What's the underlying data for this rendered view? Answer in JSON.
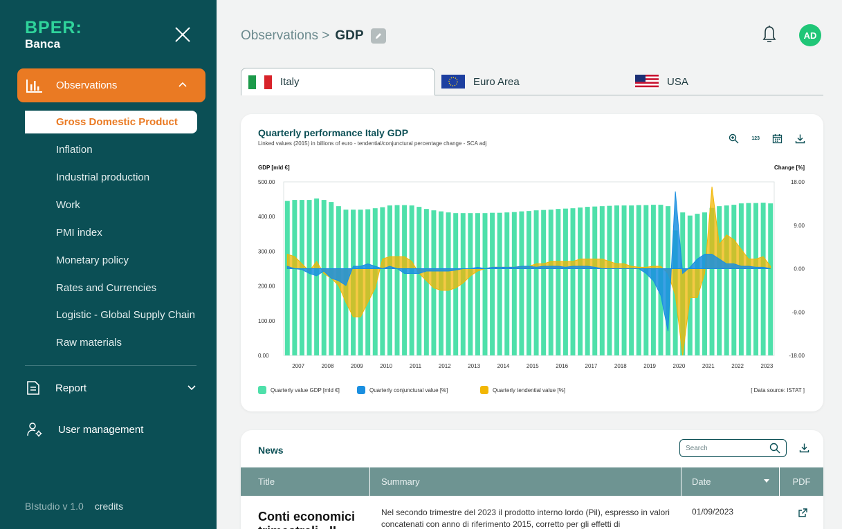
{
  "brand": {
    "line1": "BPER:",
    "line2": "Banca"
  },
  "sidebar": {
    "observations_label": "Observations",
    "sub_items": [
      "Gross Domestic Product",
      "Inflation",
      "Industrial production",
      "Work",
      "PMI index",
      "Monetary policy",
      "Rates and Currencies",
      "Logistic - Global Supply Chain",
      "Raw materials"
    ],
    "report_label": "Report",
    "user_mgmt_label": "User management",
    "version": "BIstudio v 1.0",
    "credits": "credits"
  },
  "header": {
    "crumb_root": "Observations >",
    "crumb_current": "GDP",
    "avatar": "AD"
  },
  "tabs": [
    "Italy",
    "Euro Area",
    "USA"
  ],
  "chart_card": {
    "title": "Quarterly performance Italy GDP",
    "subtitle": "Linked values (2015) in billions of euro - tendential/conjunctural percentage change - SCA adj",
    "icon_123": "123",
    "data_source": "[ Data source: ISTAT ]"
  },
  "chart_data": {
    "type": "bar",
    "title": "Quarterly performance Italy GDP",
    "ylabel": "GDP [mld €]",
    "y2label": "Change [%]",
    "ylim": [
      0,
      500
    ],
    "y2lim": [
      -18,
      18
    ],
    "yticks": [
      "500.00",
      "400.00",
      "300.00",
      "200.00",
      "100.00",
      "0.00"
    ],
    "y2ticks": [
      "18.00",
      "9.00",
      "0.00",
      "-9.00",
      "-18.00"
    ],
    "xticks": [
      "2007",
      "2008",
      "2009",
      "2010",
      "2011",
      "2012",
      "2013",
      "2014",
      "2015",
      "2016",
      "2017",
      "2018",
      "2019",
      "2020",
      "2021",
      "2022",
      "2023"
    ],
    "colors": {
      "gdp": "#4ee0aa",
      "conj": "#1a8fe0",
      "tend": "#f2b705"
    },
    "series": [
      {
        "name": "Quarterly value GDP [mld €]",
        "values": [
          445,
          448,
          448,
          448,
          452,
          448,
          442,
          430,
          420,
          420,
          420,
          421,
          424,
          427,
          432,
          433,
          433,
          432,
          428,
          422,
          418,
          415,
          412,
          410,
          410,
          410,
          410,
          410,
          411,
          411,
          412,
          413,
          415,
          416,
          418,
          419,
          420,
          422,
          423,
          424,
          426,
          428,
          429,
          430,
          431,
          432,
          432,
          432,
          433,
          433,
          434,
          434,
          430,
          360,
          412,
          403,
          408,
          412,
          425,
          430,
          432,
          434,
          438,
          439,
          439,
          440,
          438
        ]
      },
      {
        "name": "Quarterly conjunctural value [%]",
        "values": [
          0.5,
          0,
          -0.2,
          -1,
          -1.5,
          -0.5,
          -2,
          -2.5,
          -3.5,
          0.5,
          0.5,
          1,
          0.5,
          0,
          0.5,
          0,
          -1,
          -1,
          -1,
          -0.5,
          -0.5,
          -0.5,
          -0.5,
          -0.3,
          0,
          0,
          0.3,
          0,
          0.3,
          0.3,
          0.3,
          0.3,
          0.5,
          0.5,
          0.3,
          0.5,
          0.5,
          0.5,
          0.3,
          0.5,
          0.5,
          0.5,
          0.3,
          0,
          0,
          0,
          0,
          0,
          0,
          -1,
          -2.5,
          -5.5,
          -13,
          16,
          -1,
          0.3,
          2,
          3,
          3,
          2,
          1,
          1,
          0.5,
          0.5,
          0.3,
          0.3,
          0
        ]
      },
      {
        "name": "Quarterly tendential value [%]",
        "values": [
          3,
          2.5,
          1,
          -0.5,
          1.5,
          -1,
          -2,
          -3.5,
          -7,
          -10,
          -10,
          -7,
          -4,
          2,
          2.5,
          2.5,
          2.5,
          1.5,
          -1,
          -2.5,
          -4,
          -4.5,
          -4.5,
          -4,
          -3,
          -1.5,
          -0.5,
          0,
          0.3,
          0.3,
          0.3,
          0.3,
          0.5,
          0.5,
          1,
          1,
          1.5,
          1.5,
          1.5,
          1.5,
          2,
          2,
          2,
          2,
          1.5,
          1,
          1,
          0.5,
          0.3,
          0.3,
          0.5,
          0.5,
          -1,
          -5.5,
          -18,
          -6,
          -6,
          -1,
          17,
          5,
          7,
          6,
          4,
          2,
          2,
          2.5,
          0.5
        ]
      }
    ],
    "legend_position": "bottom-left"
  },
  "news": {
    "title": "News",
    "search_placeholder": "Search",
    "columns": [
      "Title",
      "Summary",
      "Date",
      "PDF"
    ],
    "rows": [
      {
        "title": "Conti economici trimestrali - II",
        "summary": "Nel secondo trimestre del 2023 il prodotto interno lordo (Pil), espresso in valori concatenati con anno di riferimento 2015, corretto per gli effetti di",
        "date": "01/09/2023"
      }
    ]
  }
}
